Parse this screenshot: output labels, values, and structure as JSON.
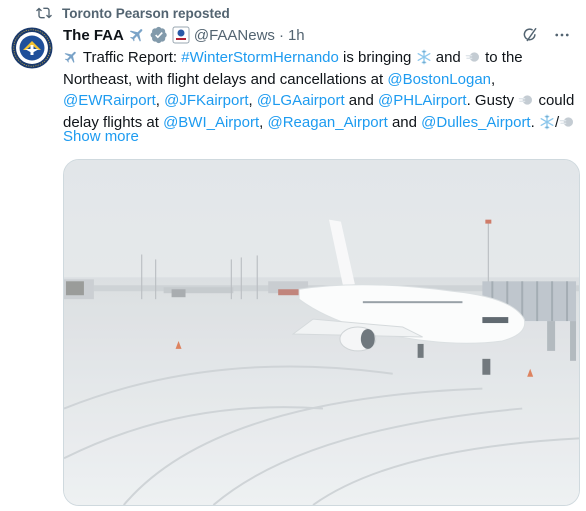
{
  "repost": {
    "label": "Toronto Pearson reposted",
    "icon": "repost-icon"
  },
  "author": {
    "avatar_icon": "faa-seal-avatar",
    "display_name": "The FAA",
    "handle": "@FAANews",
    "separator": "·",
    "time": "1h",
    "badges": [
      "airplane-emoji",
      "verified-badge-icon",
      "government-affiliation-badge"
    ]
  },
  "actions": {
    "grok_icon": "grok-icon",
    "more_icon": "more-icon"
  },
  "tweet": {
    "t01": "Traffic Report: ",
    "t02": "#WinterStormHernando",
    "t03": " is bringing ",
    "t04": " and ",
    "t05": " to the Northeast, with flight delays and cancellations at ",
    "t06": "@BostonLogan",
    "t07": ", ",
    "t08": "@EWRairport",
    "t09": ", ",
    "t10": "@JFKairport",
    "t11": ", ",
    "t12": "@LGAairport",
    "t13": " and ",
    "t14": "@PHLAirport",
    "t15": ". Gusty ",
    "t16": " could delay flights at ",
    "t17": "@BWI_Airport",
    "t18": ", ",
    "t19": "@Reagan_Airport",
    "t20": " and ",
    "t21": "@Dulles_Airport",
    "t22": ". ",
    "t23": "/",
    "show_more": "Show more"
  },
  "media": {
    "description_icon": "snowy-airport-photo"
  },
  "colors": {
    "link": "#1d9bf0",
    "text": "#0f1419",
    "muted": "#536471",
    "border": "#cfd9de"
  }
}
